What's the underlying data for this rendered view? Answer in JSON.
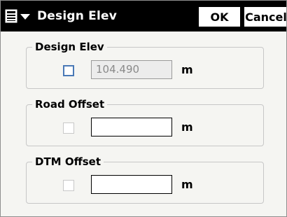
{
  "window": {
    "title": "Design Elev",
    "menu_icon": "document-menu-icon",
    "dropdown_icon": "chevron-down-icon"
  },
  "buttons": {
    "ok_label": "OK",
    "cancel_label": "Cancel"
  },
  "groups": [
    {
      "label": "Design Elev",
      "checkbox_checked": false,
      "checkbox_style": "focused",
      "value": "104.490",
      "unit": "m",
      "field_disabled": true
    },
    {
      "label": "Road Offset",
      "checkbox_checked": false,
      "value": "",
      "unit": "m",
      "field_disabled": false
    },
    {
      "label": "DTM Offset",
      "checkbox_checked": false,
      "value": "",
      "unit": "m",
      "field_disabled": false
    }
  ],
  "colors": {
    "titlebar_bg": "#000000",
    "dialog_bg": "#f5f5f2",
    "accent_checkbox": "#4a79b6"
  }
}
